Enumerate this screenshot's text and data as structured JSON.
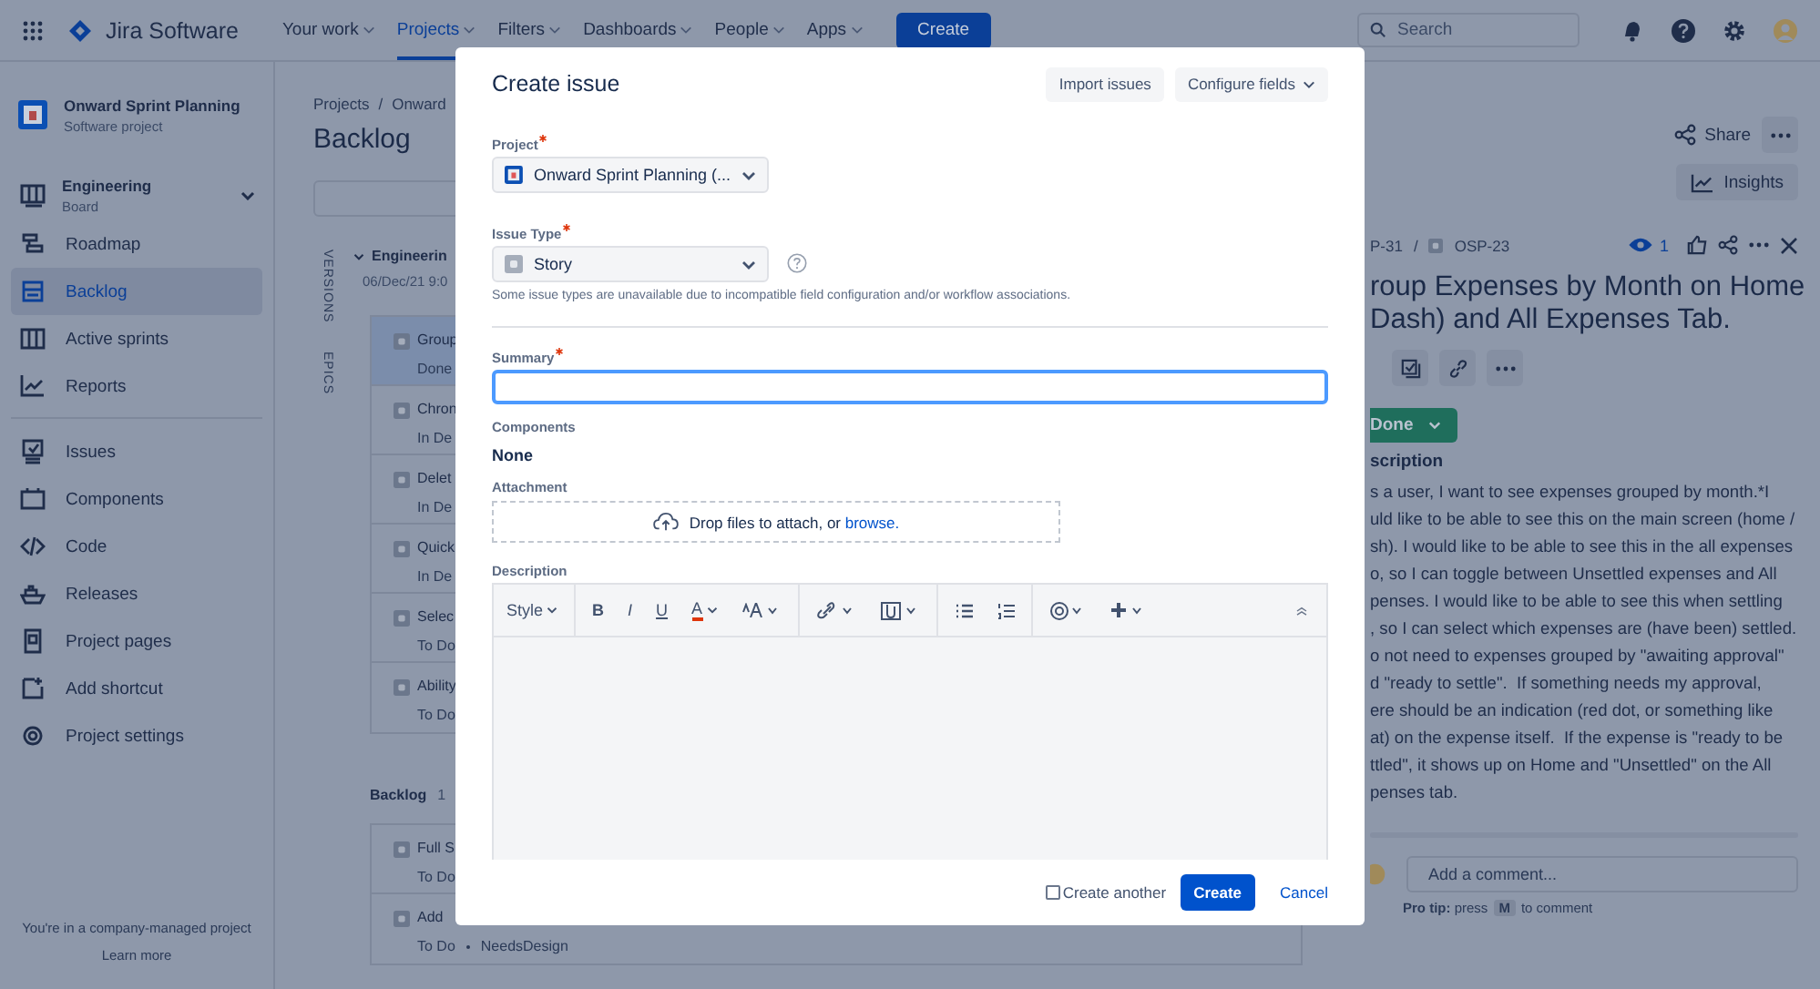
{
  "top_nav": {
    "product": "Jira Software",
    "menu": [
      {
        "label": "Your work",
        "selected": false
      },
      {
        "label": "Projects",
        "selected": true
      },
      {
        "label": "Filters",
        "selected": false
      },
      {
        "label": "Dashboards",
        "selected": false
      },
      {
        "label": "People",
        "selected": false
      },
      {
        "label": "Apps",
        "selected": false
      }
    ],
    "create_button": "Create",
    "search": {
      "placeholder": "Search"
    }
  },
  "sidebar": {
    "project": {
      "name": "Onward Sprint Planning",
      "type": "Software project"
    },
    "board": {
      "name": "Engineering",
      "type": "Board"
    },
    "planning_items": [
      {
        "label": "Roadmap",
        "selected": false
      },
      {
        "label": "Backlog",
        "selected": true
      },
      {
        "label": "Active sprints",
        "selected": false
      },
      {
        "label": "Reports",
        "selected": false
      }
    ],
    "development_items": [
      {
        "label": "Issues",
        "selected": false
      },
      {
        "label": "Components",
        "selected": false
      },
      {
        "label": "Code",
        "selected": false
      },
      {
        "label": "Releases",
        "selected": false
      },
      {
        "label": "Project pages",
        "selected": false
      },
      {
        "label": "Add shortcut",
        "selected": false
      },
      {
        "label": "Project settings",
        "selected": false
      }
    ],
    "footer_note": "You're in a company-managed project",
    "footer_link": "Learn more"
  },
  "backlog": {
    "breadcrumb": [
      "Projects",
      "Onward"
    ],
    "breadcrumb_separator": "/",
    "title": "Backlog",
    "side_tabs": [
      "VERSIONS",
      "EPICS"
    ],
    "sprint": {
      "name": "Engineerin",
      "date": "06/Dec/21 9:0",
      "issues": [
        {
          "summary": "Group",
          "status": "Done",
          "selected": true
        },
        {
          "summary": "Chron",
          "status": "In De",
          "selected": false
        },
        {
          "summary": "Delet",
          "status": "In De",
          "selected": false
        },
        {
          "summary": "Quick",
          "status": "In De",
          "selected": false
        },
        {
          "summary": "Selec",
          "status": "To Do",
          "selected": false
        },
        {
          "summary": "Ability",
          "status": "To Do",
          "selected": false
        }
      ]
    },
    "backlog_section": {
      "title": "Backlog",
      "count": "1",
      "issues": [
        {
          "summary": "Full S",
          "status": "To Do",
          "selected": false
        },
        {
          "summary": "Add",
          "status": "To Do",
          "label": "NeedsDesign",
          "selected": false
        }
      ]
    }
  },
  "detail": {
    "share_button": "Share",
    "insights_button": "Insights",
    "breadcrumb": [
      "P-31",
      "OSP-23"
    ],
    "breadcrumb_separator": "/",
    "watchers": "1",
    "title_lines": [
      "roup Expenses by Month on Home",
      "Dash) and All Expenses Tab."
    ],
    "status": "Done",
    "description_heading": "scription",
    "description_lines": [
      "s a user, I want to see expenses grouped by month.*I",
      "uld like to be able to see this on the main screen (home /",
      "sh). I would like to be able to see this in the all expenses",
      "o, so I can toggle between Unsettled expenses and All",
      "penses. I would like to be able to see this when settling",
      ", so I can select which expenses are (have been) settled.",
      "o not need to expenses grouped by \"awaiting approval\"",
      "d \"ready to settle\".  If something needs my approval,",
      "ere should be an indication (red dot, or something like",
      "at) on the expense itself.  If the expense is \"ready to be",
      "ttled\", it shows up on Home and \"Unsettled\" on the All",
      "penses tab."
    ],
    "comment": {
      "placeholder": "Add a comment..."
    },
    "pro_tip": {
      "text": "**Pro tip:** press",
      "key": "M",
      "after": "to comment"
    }
  },
  "modal": {
    "title": "Create issue",
    "header_buttons": [
      {
        "label": "Import issues",
        "kind": "plain"
      },
      {
        "label": "Configure fields",
        "kind": "dropdown"
      }
    ],
    "project": {
      "label": "Project",
      "required": true,
      "value": "Onward Sprint Planning (..."
    },
    "issue_type": {
      "label": "Issue Type",
      "required": true,
      "value": "Story",
      "hint": "Some issue types are unavailable due to incompatible field configuration and/or workflow associations."
    },
    "summary": {
      "label": "Summary",
      "required": true,
      "focused": true
    },
    "components": {
      "label": "Components",
      "value": "None"
    },
    "attachment": {
      "label": "Attachment",
      "text": "Drop files to attach, or",
      "link": "browse."
    },
    "description": {
      "label": "Description",
      "style_menu": "Style",
      "format_buttons": [
        "B",
        "I",
        "U"
      ],
      "text_color": "A"
    },
    "footer": {
      "create_another": {
        "label": "Create another",
        "checked": false
      },
      "create_button": "Create",
      "cancel_link": "Cancel"
    }
  }
}
